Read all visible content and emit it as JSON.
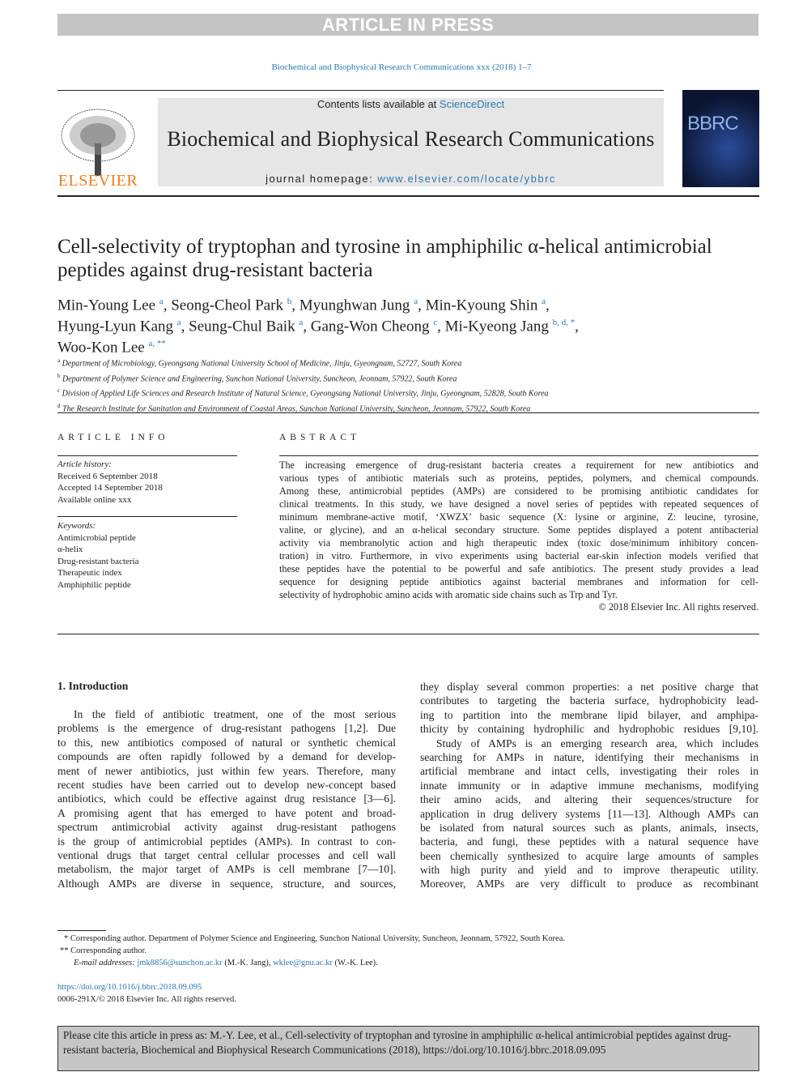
{
  "banner": "ARTICLE IN PRESS",
  "journal_ref": "Biochemical and Biophysical Research Communications xxx (2018) 1–7",
  "masthead": {
    "publisher_logo": "ELSEVIER",
    "contents_prefix": "Contents lists available at ",
    "contents_link": "ScienceDirect",
    "journal_title": "Biochemical and Biophysical Research Communications",
    "homepage_prefix": "journal homepage: ",
    "homepage_link": "www.elsevier.com/locate/ybbrc",
    "cover_text": "BBRC"
  },
  "title": "Cell-selectivity of tryptophan and tyrosine in amphiphilic α-helical antimicrobial peptides against drug-resistant bacteria",
  "authors": [
    {
      "name": "Min-Young Lee",
      "aff": "a",
      "sep": ", "
    },
    {
      "name": "Seong-Cheol Park",
      "aff": "b",
      "sep": ", "
    },
    {
      "name": "Myunghwan Jung",
      "aff": "a",
      "sep": ", "
    },
    {
      "name": "Min-Kyoung Shin",
      "aff": "a",
      "sep": ","
    },
    {
      "name": "Hyung-Lyun Kang",
      "aff": "a",
      "sep": ", "
    },
    {
      "name": "Seung-Chul Baik",
      "aff": "a",
      "sep": ", "
    },
    {
      "name": "Gang-Won Cheong",
      "aff": "c",
      "sep": ", "
    },
    {
      "name": "Mi-Kyeong Jang",
      "aff": "b, d, *",
      "sep": ","
    },
    {
      "name": "Woo-Kon Lee",
      "aff": "a, **",
      "sep": ""
    }
  ],
  "affiliations": [
    {
      "key": "a",
      "text": "Department of Microbiology, Gyeongsang National University School of Medicine, Jinju, Gyeongnam, 52727, South Korea"
    },
    {
      "key": "b",
      "text": "Department of Polymer Science and Engineering, Sunchon National University, Suncheon, Jeonnam, 57922, South Korea"
    },
    {
      "key": "c",
      "text": "Division of Applied Life Sciences and Research Institute of Natural Science, Gyeongsang National University, Jinju, Gyeongnam, 52828, South Korea"
    },
    {
      "key": "d",
      "text": "The Research Institute for Sanitation and Environment of Coastal Areas, Sunchon National University, Suncheon, Jeonnam, 57922, South Korea"
    }
  ],
  "article_info": {
    "heading": "ARTICLE INFO",
    "history_label": "Article history:",
    "history": [
      "Received 6 September 2018",
      "Accepted 14 September 2018",
      "Available online xxx"
    ],
    "keywords_label": "Keywords:",
    "keywords": [
      "Antimicrobial peptide",
      "α-helix",
      "Drug-resistant bacteria",
      "Therapeutic index",
      "Amphiphilic peptide"
    ]
  },
  "abstract": {
    "heading": "ABSTRACT",
    "lines": [
      "The increasing emergence of drug-resistant bacteria creates a requirement for new antibiotics and",
      "various types of antibiotic materials such as proteins, peptides, polymers, and chemical compounds.",
      "Among these, antimicrobial peptides (AMPs) are considered to be promising antibiotic candidates for",
      "clinical treatments. In this study, we have designed a novel series of peptides with repeated sequences of",
      "minimum membrane-active motif, ‘XWZX’ basic sequence (X: lysine or arginine, Z: leucine, tyrosine,",
      "valine, or glycine), and an α-helical secondary structure. Some peptides displayed a potent antibacterial",
      "activity via membranolytic action and high therapeutic index (toxic dose/minimum inhibitory concen-",
      "tration) in vitro. Furthermore, in vivo experiments using bacterial ear-skin infection models verified that",
      "these peptides have the potential to be powerful and safe antibiotics. The present study provides a lead",
      "sequence for designing peptide antibiotics against bacterial membranes and information for cell-",
      "selectivity of hydrophobic amino acids with aromatic side chains such as Trp and Tyr."
    ],
    "copyright": "© 2018 Elsevier Inc. All rights reserved."
  },
  "intro": {
    "heading": "1.  Introduction",
    "left_lines": [
      "In the field of antibiotic treatment, one of the most serious",
      "problems is the emergence of drug-resistant pathogens [1,2]. Due",
      "to this, new antibiotics composed of natural or synthetic chemical",
      "compounds are often rapidly followed by a demand for develop-",
      "ment of newer antibiotics, just within few years. Therefore, many",
      "recent studies have been carried out to develop new-concept based",
      "antibiotics, which could be effective against drug resistance [3—6].",
      "A promising agent that has emerged to have potent and broad-",
      "spectrum antimicrobial activity against drug-resistant pathogens",
      "is the group of antimicrobial peptides (AMPs). In contrast to con-",
      "ventional drugs that target central cellular processes and cell wall",
      "metabolism, the major target of AMPs is cell membrane [7—10].",
      "Although AMPs are diverse in sequence, structure, and sources,"
    ],
    "right_lines": [
      "they display several common properties: a net positive charge that",
      "contributes to targeting the bacteria surface, hydrophobicity lead-",
      "ing to partition into the membrane lipid bilayer, and amphipa-",
      "thicity by containing hydrophilic and hydrophobic residues [9,10].",
      "Study of AMPs is an emerging research area, which includes",
      "searching for AMPs in nature, identifying their mechanisms in",
      "artificial membrane and intact cells, investigating their roles in",
      "innate immunity or in adaptive immune mechanisms, modifying",
      "their amino acids, and altering their sequences/structure for",
      "application in drug delivery systems [11—13]. Although AMPs can",
      "be isolated from natural sources such as plants, animals, insects,",
      "bacteria, and fungi, these peptides with a natural sequence have",
      "been chemically synthesized to acquire large amounts of samples",
      "with high purity and yield and to improve therapeutic utility.",
      "Moreover, AMPs are very difficult to produce as recombinant"
    ]
  },
  "footnotes": {
    "star1": "* Corresponding author. Department of Polymer Science and Engineering, Sunchon National University, Suncheon, Jeonnam, 57922, South Korea.",
    "star2": "** Corresponding author.",
    "email_label": "E-mail addresses: ",
    "email1": "jmk8856@sunchon.ac.kr",
    "email1_who": " (M.-K. Jang), ",
    "email2": "wklee@gnu.ac.kr",
    "email2_who": " (W.-K. Lee).",
    "doi": "https://doi.org/10.1016/j.bbrc.2018.09.095",
    "issn": "0006-291X/© 2018 Elsevier Inc. All rights reserved."
  },
  "cite_box": "Please cite this article in press as: M.-Y. Lee, et al., Cell-selectivity of tryptophan and tyrosine in amphiphilic α-helical antimicrobial peptides against drug-resistant bacteria, Biochemical and Biophysical Research Communications (2018), https://doi.org/10.1016/j.bbrc.2018.09.095",
  "colors": {
    "link": "#2a7ab0",
    "elsevier": "#f07b1b",
    "banner": "#c4c4c4"
  }
}
